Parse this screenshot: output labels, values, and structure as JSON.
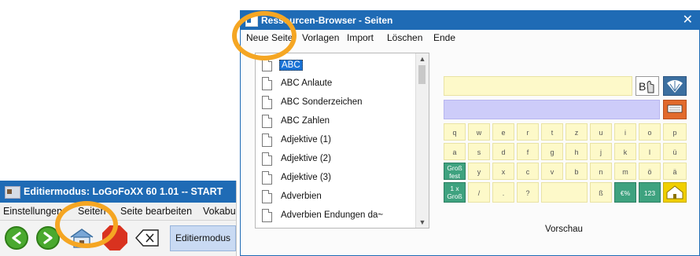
{
  "editor": {
    "title": "Editiermodus: LoGoFoXX 60 1.01 -- START",
    "menu": [
      "Einstellungen",
      "Seiten",
      "Seite bearbeiten",
      "Vokabu"
    ],
    "toolbar": {
      "back_icon": "arrow-left-icon",
      "forward_icon": "arrow-right-icon",
      "home_icon": "home-icon",
      "stop_icon": "stop-icon",
      "delete_icon": "backspace-delete-icon",
      "mode_label": "Editiermodus"
    }
  },
  "dialog": {
    "title": "Ressourcen-Browser - Seiten",
    "close": "✕",
    "menu": [
      "Neue Seite",
      "Vorlagen",
      "Import",
      "Löschen",
      "Ende"
    ],
    "pages": [
      "ABC",
      "ABC Anlaute",
      "ABC Sonderzeichen",
      "ABC Zahlen",
      "Adjektive (1)",
      "Adjektive (2)",
      "Adjektive (3)",
      "Adverbien",
      "Adverbien Endungen da~"
    ],
    "selected_index": 0,
    "preview_label": "Vorschau",
    "keyboard": {
      "row1": [
        "q",
        "w",
        "e",
        "r",
        "t",
        "z",
        "u",
        "i",
        "o",
        "p"
      ],
      "row2": [
        "a",
        "s",
        "d",
        "f",
        "g",
        "h",
        "j",
        "k",
        "l",
        "ü"
      ],
      "row3": [
        "Groß fest",
        "y",
        "x",
        "c",
        "v",
        "b",
        "n",
        "m",
        "ö",
        "ä"
      ],
      "row4": [
        "1 x Groß",
        "/",
        ".",
        "?",
        "",
        "ß",
        "€%",
        "123",
        ""
      ]
    },
    "colors": {
      "titlebar": "#1f6bb5",
      "key_yellow": "#fdf9c9",
      "key_green": "#3ea27f",
      "highlight": "#f5a623"
    }
  }
}
